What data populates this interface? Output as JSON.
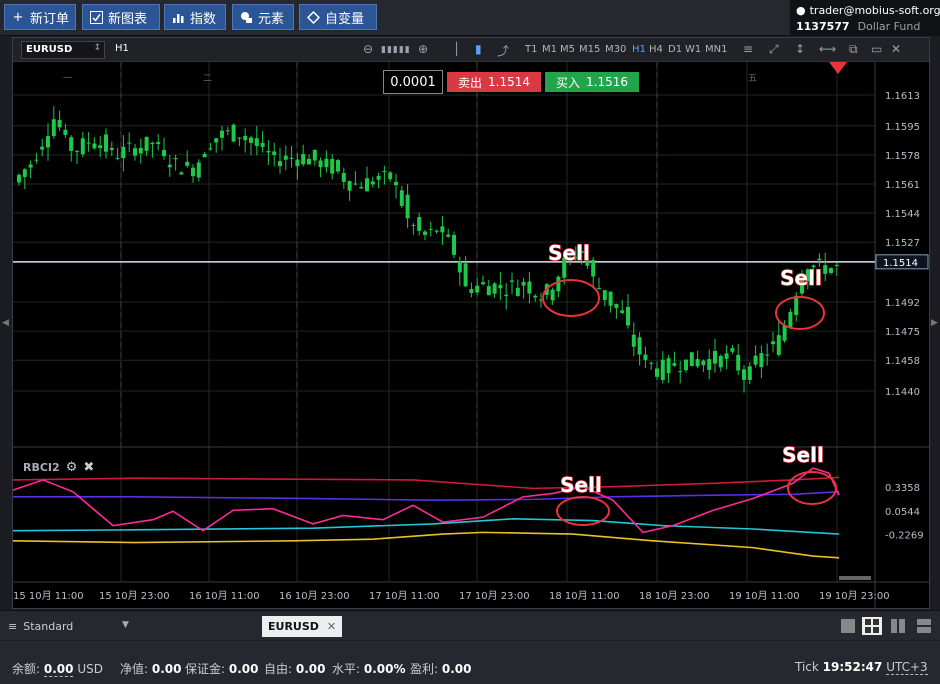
{
  "toolbar": {
    "new_order": "新订单",
    "new_chart": "新图表",
    "indicators": "指数",
    "elements": "元素",
    "variables": "自变量"
  },
  "account": {
    "user": "trader@mobius-soft.org",
    "number": "1137577",
    "fund": "Dollar Fund"
  },
  "chart_header": {
    "symbol": "EURUSD",
    "timeframe": "H1",
    "timeframes": [
      "T1",
      "M1",
      "M5",
      "M15",
      "M30",
      "H1",
      "H4",
      "D1",
      "W1",
      "MN1"
    ],
    "active_timeframe": "H1"
  },
  "trade_panel": {
    "volume": "0.0001",
    "sell_label": "卖出",
    "sell_price": "1.1514",
    "buy_label": "买入",
    "buy_price": "1.1516"
  },
  "day_markers": [
    "一",
    "二",
    "五"
  ],
  "price_axis": [
    "1.1613",
    "1.1595",
    "1.1578",
    "1.1561",
    "1.1544",
    "1.1527",
    "1.1492",
    "1.1475",
    "1.1458",
    "1.1440"
  ],
  "current_price_label": "1.1514",
  "indicator": {
    "name": "RBCI2",
    "axis": [
      "0.3358",
      "0.0544",
      "-0.2269"
    ]
  },
  "time_axis": [
    "15 10月 11:00",
    "15 10月 23:00",
    "16 10月 11:00",
    "16 10月 23:00",
    "17 10月 11:00",
    "17 10月 23:00",
    "18 10月 11:00",
    "18 10月 23:00",
    "19 10月 11:00",
    "19 10月 23:00"
  ],
  "annotations": [
    "Sell",
    "Sell",
    "Sell",
    "Sell"
  ],
  "tabs": {
    "layout": "Standard",
    "symbol_tab": "EURUSD"
  },
  "status": {
    "balance_label": "余额:",
    "balance_value": "0.00",
    "balance_currency": "USD",
    "equity_label": "净值:",
    "equity_value": "0.00",
    "margin_label": "保证金:",
    "margin_value": "0.00",
    "free_label": "自由:",
    "free_value": "0.00",
    "level_label": "水平:",
    "level_value": "0.00%",
    "pnl_label": "盈利:",
    "pnl_value": "0.00",
    "tick_label": "Tick",
    "time": "19:52:47",
    "tz": "UTC+3"
  },
  "colors": {
    "bull": "#1ec84a",
    "sell": "#d83a44",
    "buy": "#22a44a",
    "annotation": "#e8333a",
    "line_magenta": "#ff2a9a",
    "line_red": "#cc1a3a",
    "line_blue": "#5b2ee8",
    "line_cyan": "#22c6d8",
    "line_yellow": "#e8c226"
  }
}
